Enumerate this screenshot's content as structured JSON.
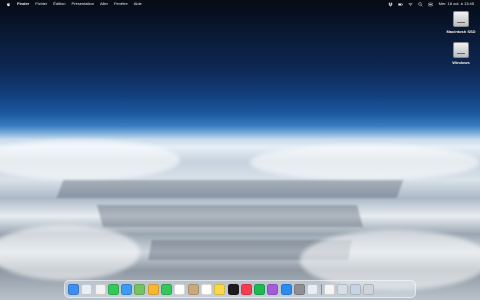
{
  "menubar": {
    "app_name": "Finder",
    "items": [
      "Fichier",
      "Édition",
      "Présentation",
      "Aller",
      "Fenêtre",
      "Aide"
    ],
    "clock": "Mer. 18 oct. à 13:45"
  },
  "desktop_icons": [
    {
      "label": "Macintosh SSD",
      "icon": "hard-drive-icon"
    },
    {
      "label": "Windows",
      "icon": "hard-drive-icon"
    }
  ],
  "dock": {
    "apps": [
      {
        "name": "finder-icon",
        "color": "#3d8ef0"
      },
      {
        "name": "launchpad-icon",
        "color": "#e9eef5"
      },
      {
        "name": "chrome-icon",
        "color": "#f3f3f3"
      },
      {
        "name": "messages-icon",
        "color": "#34c759"
      },
      {
        "name": "mail-icon",
        "color": "#3d9bf5"
      },
      {
        "name": "maps-icon",
        "color": "#74c365"
      },
      {
        "name": "photos-icon",
        "color": "#f7b733"
      },
      {
        "name": "facetime-icon",
        "color": "#34c759"
      },
      {
        "name": "calendar-icon",
        "color": "#ffffff"
      },
      {
        "name": "contacts-icon",
        "color": "#c9a97c"
      },
      {
        "name": "reminders-icon",
        "color": "#ffffff"
      },
      {
        "name": "notes-icon",
        "color": "#f9d94a"
      },
      {
        "name": "apple-tv-icon",
        "color": "#1c1c1e"
      },
      {
        "name": "music-icon",
        "color": "#fa3c50"
      },
      {
        "name": "spotify-icon",
        "color": "#1db954"
      },
      {
        "name": "podcasts-icon",
        "color": "#a45cdc"
      },
      {
        "name": "app-store-icon",
        "color": "#2a8cf2"
      },
      {
        "name": "system-settings-icon",
        "color": "#8e8e93"
      },
      {
        "name": "preview-icon",
        "color": "#e9eef5"
      }
    ],
    "recent": [
      {
        "name": "text-edit-icon",
        "color": "#f5f5f5"
      },
      {
        "name": "screenshot-icon",
        "color": "#d7dde5"
      },
      {
        "name": "downloads-folder-icon",
        "color": "#c9d4e2"
      },
      {
        "name": "trash-icon",
        "color": "#cfd4da"
      }
    ]
  }
}
